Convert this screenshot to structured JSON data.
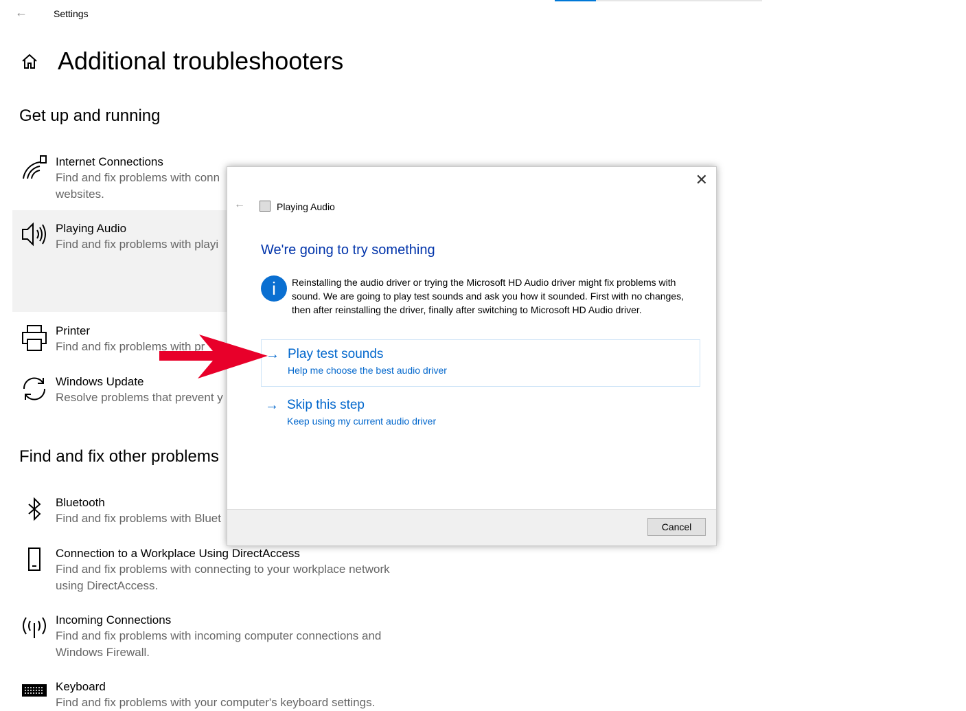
{
  "window": {
    "title": "Settings",
    "progress_percent": 20
  },
  "page": {
    "title": "Additional troubleshooters"
  },
  "sections": [
    {
      "heading": "Get up and running",
      "items": [
        {
          "icon": "wifi-icon",
          "title": "Internet Connections",
          "desc": "Find and fix problems with conn websites."
        },
        {
          "icon": "speaker-icon",
          "title": "Playing Audio",
          "desc": "Find and fix problems with playi"
        },
        {
          "icon": "printer-icon",
          "title": "Printer",
          "desc": "Find and fix problems with pr"
        },
        {
          "icon": "sync-icon",
          "title": "Windows Update",
          "desc": "Resolve problems that prevent y"
        }
      ]
    },
    {
      "heading": "Find and fix other problems",
      "items": [
        {
          "icon": "bluetooth-icon",
          "title": "Bluetooth",
          "desc": "Find and fix problems with Bluet"
        },
        {
          "icon": "phone-icon",
          "title": "Connection to a Workplace Using DirectAccess",
          "desc": "Find and fix problems with connecting to your workplace network using DirectAccess."
        },
        {
          "icon": "antenna-icon",
          "title": "Incoming Connections",
          "desc": "Find and fix problems with incoming computer connections and Windows Firewall."
        },
        {
          "icon": "keyboard-icon",
          "title": "Keyboard",
          "desc": "Find and fix problems with your computer's keyboard settings."
        }
      ]
    }
  ],
  "dialog": {
    "title": "Playing Audio",
    "heading": "We're going to try something",
    "info": "Reinstalling the audio driver or trying the Microsoft HD Audio driver might fix problems with sound. We are going to play test sounds and ask you how it sounded. First with no changes, then after reinstalling the driver, finally after switching to Microsoft HD Audio driver.",
    "options": [
      {
        "title": "Play test sounds",
        "subtitle": "Help me choose the best audio driver"
      },
      {
        "title": "Skip this step",
        "subtitle": "Keep using my current audio driver"
      }
    ],
    "cancel": "Cancel"
  },
  "colors": {
    "accent": "#0066cc",
    "annotation_arrow": "#e8002a"
  }
}
